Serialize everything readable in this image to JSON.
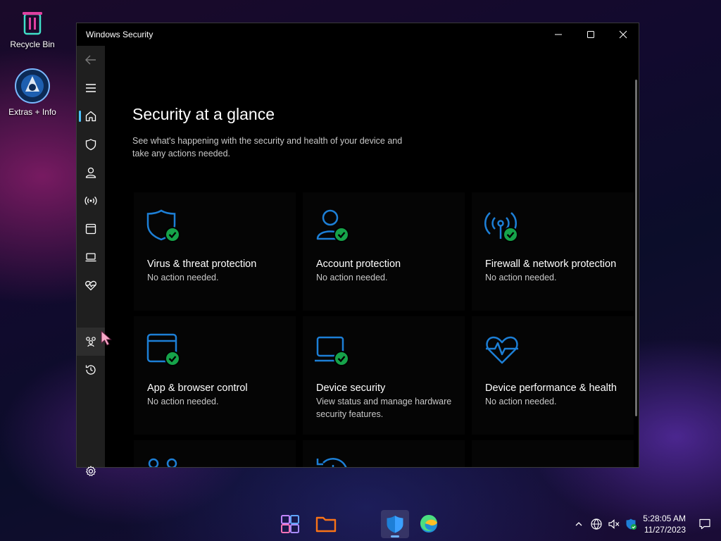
{
  "desktop": {
    "icons": [
      {
        "label": "Recycle Bin"
      },
      {
        "label": "Extras + Info"
      }
    ]
  },
  "window": {
    "title": "Windows Security"
  },
  "nav": {
    "items": [
      "back-arrow-icon",
      "hamburger-menu-icon",
      "home-icon",
      "shield-icon",
      "person-icon",
      "antenna-icon",
      "browser-window-icon",
      "laptop-icon",
      "heart-pulse-icon",
      "family-icon",
      "history-icon",
      "gear-icon"
    ]
  },
  "main": {
    "heading": "Security at a glance",
    "subtitle": "See what's happening with the security and health of your device and take any actions needed.",
    "tiles": [
      {
        "title": "Virus & threat protection",
        "status": "No action needed."
      },
      {
        "title": "Account protection",
        "status": "No action needed."
      },
      {
        "title": "Firewall & network protection",
        "status": "No action needed."
      },
      {
        "title": "App & browser control",
        "status": "No action needed."
      },
      {
        "title": "Device security",
        "status": "View status and manage hardware security features."
      },
      {
        "title": "Device performance & health",
        "status": "No action needed."
      },
      {
        "title": "",
        "status": ""
      },
      {
        "title": "",
        "status": ""
      }
    ]
  },
  "colors": {
    "accent": "#4cc2ff",
    "icon_blue": "#1d7fd6",
    "ok_green": "#16a34a"
  },
  "taskbar": {
    "time": "5:28:05 AM",
    "date": "11/27/2023"
  }
}
